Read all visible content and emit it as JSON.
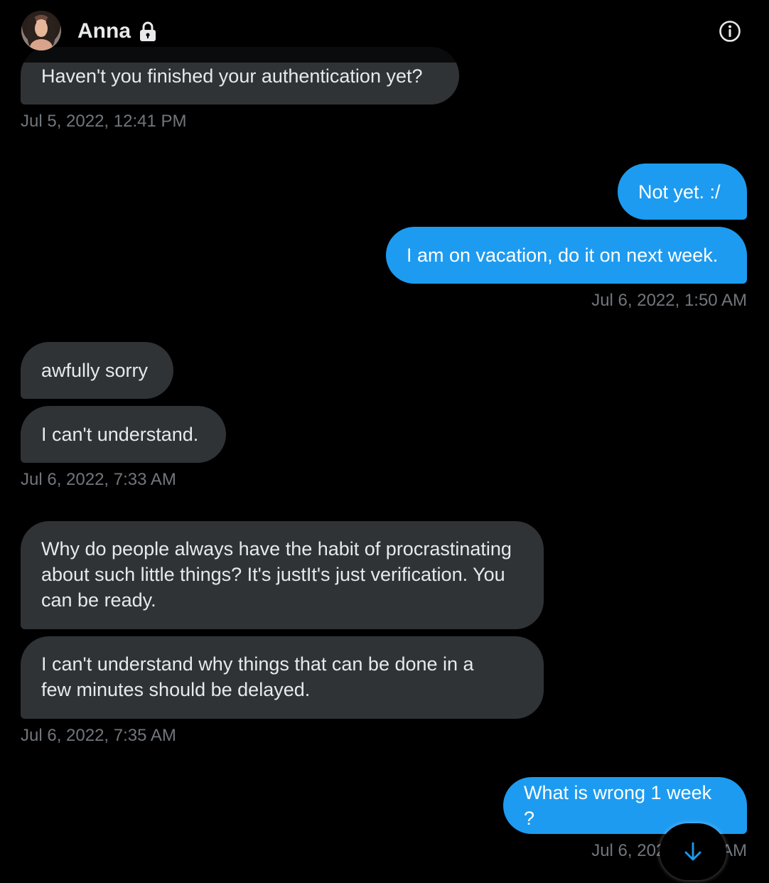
{
  "header": {
    "name": "Anna",
    "lock_icon": "lock-icon",
    "info_icon": "info-icon"
  },
  "messages": [
    {
      "side": "in",
      "text": "Haven't you finished your authentication yet?"
    },
    {
      "side": "out",
      "text": "Not yet. :/"
    },
    {
      "side": "out",
      "text": "I am on vacation, do it on next week."
    },
    {
      "side": "in",
      "text": "awfully sorry"
    },
    {
      "side": "in",
      "text": "I can't understand."
    },
    {
      "side": "in",
      "text": "Why do people always have the habit of procrastinating about such little things? It's justIt's just verification. You can be ready."
    },
    {
      "side": "in",
      "text": "I can't understand why things that can be done in a few minutes should be delayed."
    },
    {
      "side": "out",
      "text": "What is wrong 1 week ?"
    }
  ],
  "timestamps": [
    "Jul 5, 2022, 12:41 PM",
    "Jul 6, 2022, 1:50 AM",
    "Jul 6, 2022, 7:33 AM",
    "Jul 6, 2022, 7:35 AM",
    "Jul 6, 2022, 7:36 AM"
  ],
  "scroll_button": {
    "icon": "arrow-down-icon"
  },
  "colors": {
    "background": "#000000",
    "incoming_bubble": "#2f3336",
    "outgoing_bubble": "#1d9bf0",
    "timestamp": "#71767b"
  }
}
